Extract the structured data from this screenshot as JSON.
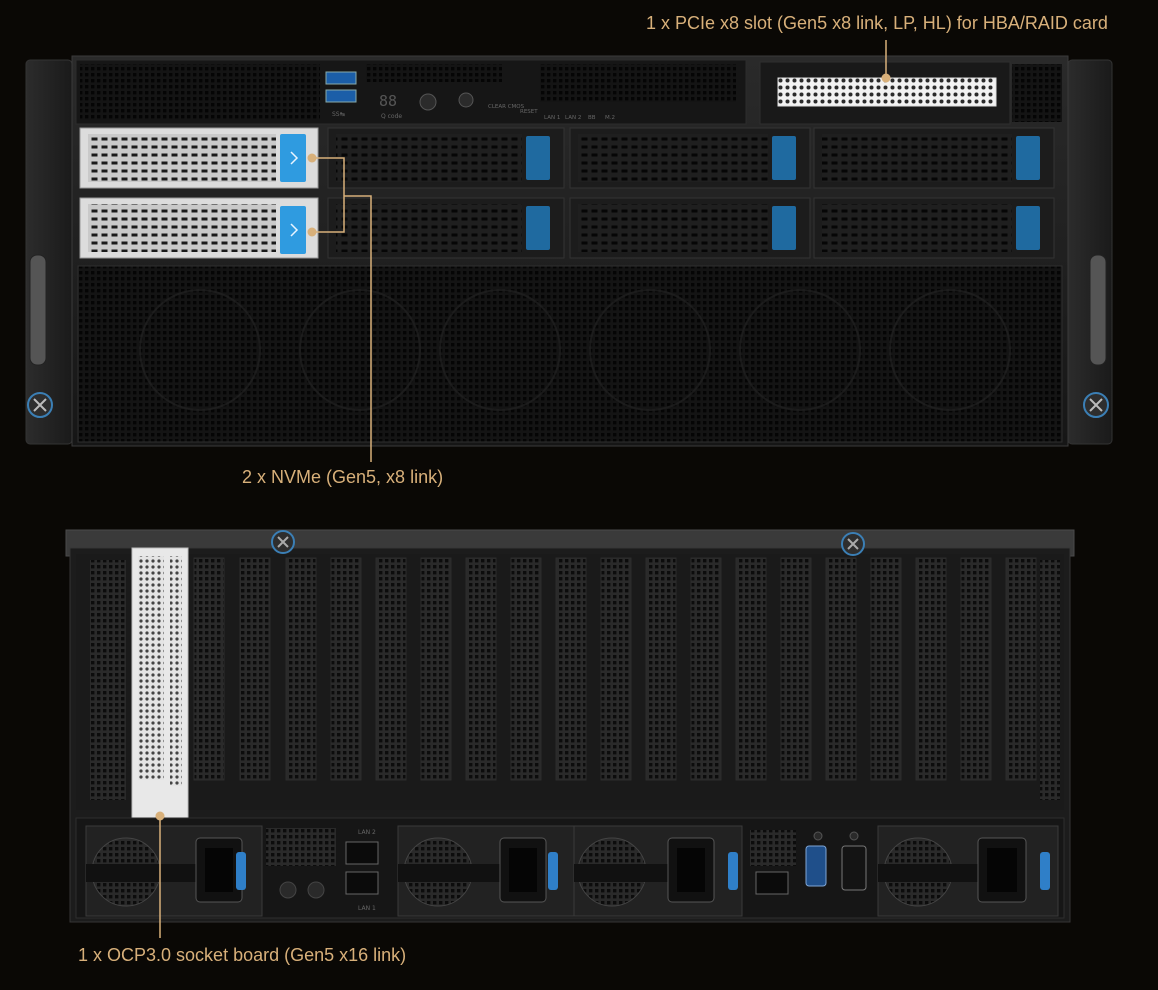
{
  "callouts": {
    "pcie_slot": "1 x PCIe x8 slot (Gen5 x8 link, LP, HL) for HBA/RAID card",
    "nvme": "2 x NVMe (Gen5, x8 link)",
    "ocp": "1 x OCP3.0 socket board (Gen5 x16 link)"
  },
  "front_panel": {
    "usb_label": "SS↹",
    "qcode_display": "88",
    "qcode_label": "Q code",
    "clear_cmos": "CLEAR CMOS",
    "reset": "RESET",
    "led_labels": [
      "LAN 1",
      "LAN 2",
      "BB",
      "M.2"
    ]
  },
  "rear_panel": {
    "lan2": "LAN 2",
    "lan1": "LAN 1"
  },
  "colors": {
    "callout": "#d8b07a",
    "drive_latch": "#2f9be0",
    "chassis": "#1a1a1a",
    "background": "#0a0805"
  }
}
